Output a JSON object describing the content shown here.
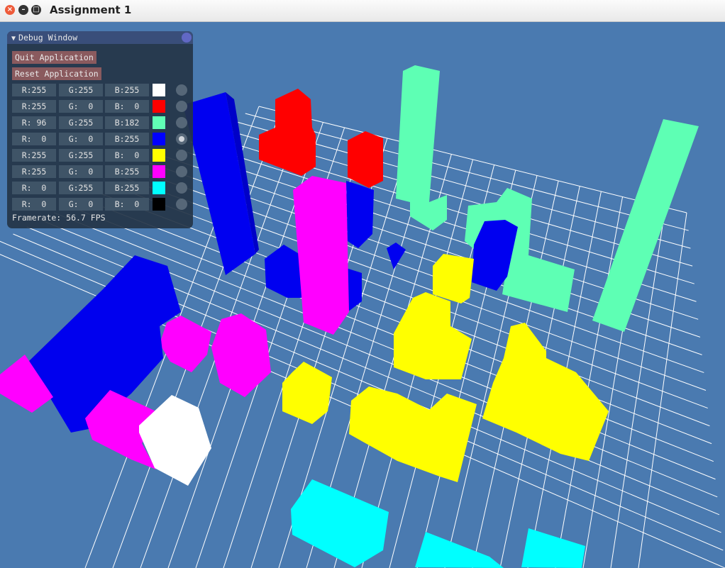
{
  "window": {
    "title": "Assignment 1"
  },
  "debug": {
    "title": "Debug Window",
    "quit_label": "Quit Application",
    "reset_label": "Reset Application",
    "colors": [
      {
        "r": "R:255",
        "g": "G:255",
        "b": "B:255",
        "swatch": "#ffffff",
        "selected": false
      },
      {
        "r": "R:255",
        "g": "G:  0",
        "b": "B:  0",
        "swatch": "#ff0000",
        "selected": false
      },
      {
        "r": "R: 96",
        "g": "G:255",
        "b": "B:182",
        "swatch": "#60ffb6",
        "selected": false
      },
      {
        "r": "R:  0",
        "g": "G:  0",
        "b": "B:255",
        "swatch": "#0000ff",
        "selected": true
      },
      {
        "r": "R:255",
        "g": "G:255",
        "b": "B:  0",
        "swatch": "#ffff00",
        "selected": false
      },
      {
        "r": "R:255",
        "g": "G:  0",
        "b": "B:255",
        "swatch": "#ff00ff",
        "selected": false
      },
      {
        "r": "R:  0",
        "g": "G:255",
        "b": "B:255",
        "swatch": "#00ffff",
        "selected": false
      },
      {
        "r": "R:  0",
        "g": "G:  0",
        "b": "B:  0",
        "swatch": "#000000",
        "selected": false
      }
    ],
    "framerate": "Framerate: 56.7 FPS"
  },
  "scene": {
    "background": "#4a7ab0",
    "grid_color": "#ffffff",
    "palette": {
      "white": "#ffffff",
      "red": "#ff0000",
      "mint": "#60ffb6",
      "blue": "#0000ff",
      "yellow": "#ffff00",
      "magenta": "#ff00ff",
      "cyan": "#00ffff"
    }
  }
}
